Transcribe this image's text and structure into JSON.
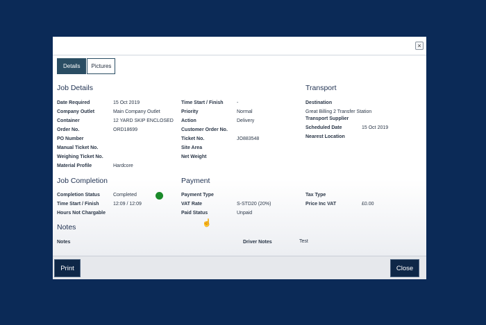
{
  "tabs": [
    {
      "label": "Details"
    },
    {
      "label": "Pictures"
    }
  ],
  "close_icon_glyph": "×",
  "job_details": {
    "title": "Job Details",
    "rows": [
      {
        "label": "Date Required",
        "value": "15 Oct 2019"
      },
      {
        "label": "Company Outlet",
        "value": "Main Company Outlet"
      },
      {
        "label": "Container",
        "value": "12 YARD SKIP ENCLOSED"
      },
      {
        "label": "Order No.",
        "value": "ORD18699"
      },
      {
        "label": "PO Number",
        "value": ""
      },
      {
        "label": "Manual Ticket No.",
        "value": ""
      },
      {
        "label": "Weighing Ticket No.",
        "value": ""
      },
      {
        "label": "Material Profile",
        "value": "Hardcore"
      }
    ]
  },
  "job_details_col2": {
    "rows": [
      {
        "label": "Time Start / Finish",
        "value": "-"
      },
      {
        "label": "Priority",
        "value": "Normal"
      },
      {
        "label": "Action",
        "value": "Delivery"
      },
      {
        "label": "Customer Order No.",
        "value": ""
      },
      {
        "label": "Ticket No.",
        "value": "JO883548"
      },
      {
        "label": "Site Area",
        "value": ""
      },
      {
        "label": "Net Weight",
        "value": ""
      }
    ]
  },
  "transport": {
    "title": "Transport",
    "destination_label": "Destination",
    "destination_value": "Great Billing 2 Transfer Station",
    "supplier_label": "Transport Supplier",
    "scheduled_label": "Scheduled Date",
    "scheduled_value": "15 Oct 2019",
    "nearest_label": "Nearest Location"
  },
  "job_completion": {
    "title": "Job Completion",
    "rows": [
      {
        "label": "Completion Status",
        "value": "Completed"
      },
      {
        "label": "Time Start / Finish",
        "value": "12:09 / 12:09"
      },
      {
        "label": "Hours Not Chargable",
        "value": ""
      }
    ],
    "status_color": "#1a8a2a"
  },
  "payment": {
    "title": "Payment",
    "rows": [
      {
        "label": "Payment Type",
        "value": ""
      },
      {
        "label": "VAT Rate",
        "value": "S-STD20 (20%)"
      },
      {
        "label": "Paid Status",
        "value": "Unpaid"
      }
    ],
    "tax_type_label": "Tax Type",
    "price_label": "Price Inc VAT",
    "price_value": "£0.00"
  },
  "notes": {
    "title": "Notes",
    "notes_label": "Notes",
    "driver_label": "Driver Notes",
    "driver_value": "Test"
  },
  "footer": {
    "print_label": "Print",
    "close_label": "Close"
  },
  "colors": {
    "background": "#0b2a57",
    "accent": "#2a4d63",
    "button": "#0e2747"
  }
}
